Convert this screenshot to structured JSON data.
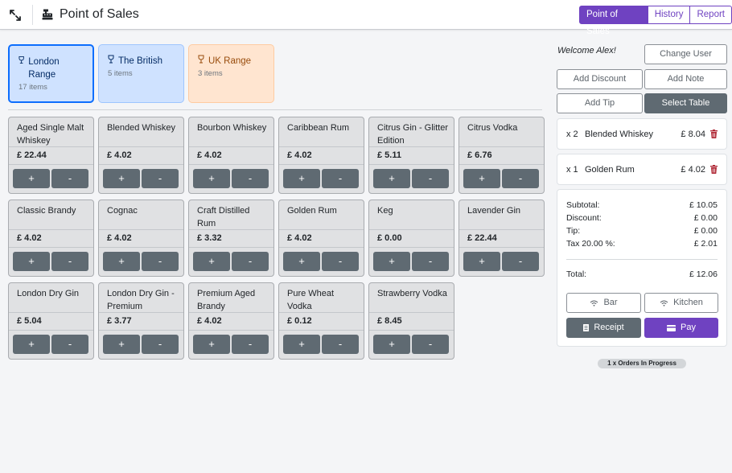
{
  "header": {
    "title": "Point of Sales",
    "nav": [
      "Point of Sales",
      "History",
      "Report"
    ]
  },
  "categories": [
    {
      "name": "London Range",
      "count": "17 items"
    },
    {
      "name": "The British",
      "count": "5 items"
    },
    {
      "name": "UK Range",
      "count": "3 items"
    }
  ],
  "products": [
    {
      "name": "Aged Single Malt Whiskey",
      "price": "£ 22.44"
    },
    {
      "name": "Blended Whiskey",
      "price": "£ 4.02"
    },
    {
      "name": "Bourbon Whiskey",
      "price": "£ 4.02"
    },
    {
      "name": "Caribbean Rum",
      "price": "£ 4.02"
    },
    {
      "name": "Citrus Gin - Glitter Edition",
      "price": "£ 5.11"
    },
    {
      "name": "Citrus Vodka",
      "price": "£ 6.76"
    },
    {
      "name": "Classic Brandy",
      "price": "£ 4.02"
    },
    {
      "name": "Cognac",
      "price": "£ 4.02"
    },
    {
      "name": "Craft Distilled Rum",
      "price": "£ 3.32"
    },
    {
      "name": "Golden Rum",
      "price": "£ 4.02"
    },
    {
      "name": "Keg",
      "price": "£ 0.00"
    },
    {
      "name": "Lavender Gin",
      "price": "£ 22.44"
    },
    {
      "name": "London Dry Gin",
      "price": "£ 5.04"
    },
    {
      "name": "London Dry Gin - Premium",
      "price": "£ 3.77"
    },
    {
      "name": "Premium Aged Brandy",
      "price": "£ 4.02"
    },
    {
      "name": "Pure Wheat Vodka",
      "price": "£ 0.12"
    },
    {
      "name": "Strawberry Vodka",
      "price": "£ 8.45"
    }
  ],
  "qty_labels": {
    "plus": "+",
    "minus": "-"
  },
  "sidebar": {
    "welcome": "Welcome Alex!",
    "change_user": "Change User",
    "add_discount": "Add Discount",
    "add_note": "Add Note",
    "add_tip": "Add Tip",
    "select_table": "Select Table"
  },
  "order_items": [
    {
      "qty": "x 2",
      "name": "Blended Whiskey",
      "price": "£ 8.04"
    },
    {
      "qty": "x 1",
      "name": "Golden Rum",
      "price": "£ 4.02"
    }
  ],
  "summary": {
    "subtotal_label": "Subtotal:",
    "subtotal": "£ 10.05",
    "discount_label": "Discount:",
    "discount": "£ 0.00",
    "tip_label": "Tip:",
    "tip": "£ 0.00",
    "tax_label": "Tax 20.00 %:",
    "tax": "£ 2.01",
    "total_label": "Total:",
    "total": "£ 12.06"
  },
  "actions": {
    "bar": "Bar",
    "kitchen": "Kitchen",
    "receipt": "Receipt",
    "pay": "Pay"
  },
  "orders_in_progress": "1 x Orders In Progress",
  "colors": {
    "accent": "#6f42c1",
    "dark_button": "#5f6a72",
    "category_blue": "#cfe2ff",
    "category_orange": "#ffe5d0",
    "delete": "#b02a37"
  }
}
